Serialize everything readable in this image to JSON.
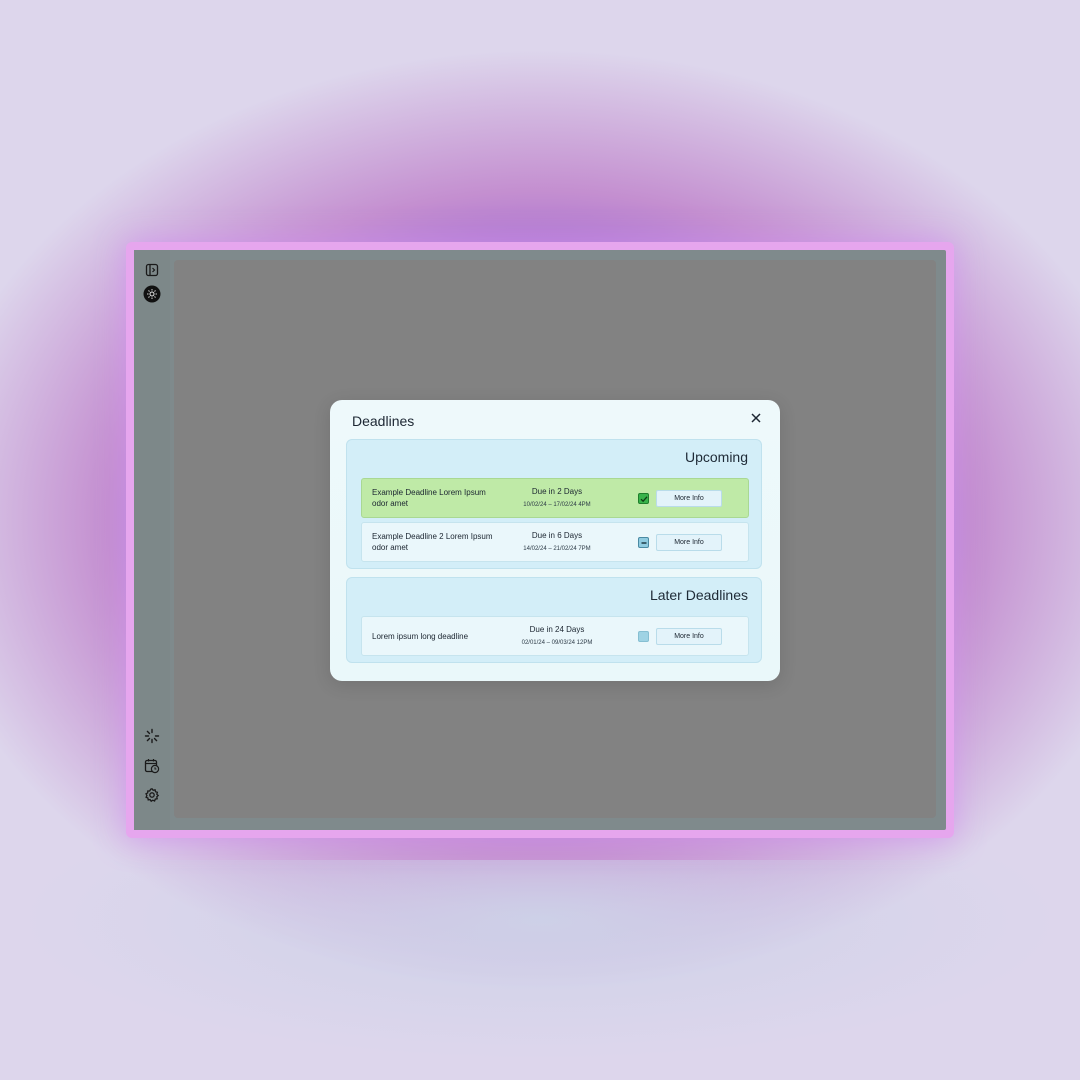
{
  "colors": {
    "backdrop": "#ddd6ec",
    "glow_purple": "#6a45e0",
    "device_frame": "#e6a6ee",
    "overlay": "#828282",
    "modal_bg": "#eef9fb",
    "section_bg": "#d3eef8",
    "done_row_bg": "#bfeaa7",
    "check_green": "#38b34a"
  },
  "sidebar": {
    "top_icons": [
      "sidebar-toggle-icon",
      "sun-icon"
    ],
    "bottom_icons": [
      "loading-spinner-icon",
      "calendar-clock-icon",
      "gear-icon"
    ]
  },
  "modal": {
    "title": "Deadlines",
    "close_icon": "close-icon",
    "sections": [
      {
        "title": "Upcoming",
        "rows": [
          {
            "name": "Example Deadline Lorem Ipsum odor amet",
            "due": "Due in 2 Days",
            "range": "10/02/24 – 17/02/24 4PM",
            "status": "checked",
            "button": "More Info"
          },
          {
            "name": "Example Deadline 2 Lorem Ipsum odor amet",
            "due": "Due in 6 Days",
            "range": "14/02/24 – 21/02/24 7PM",
            "status": "partial",
            "button": "More Info"
          }
        ]
      },
      {
        "title": "Later Deadlines",
        "rows": [
          {
            "name": "Lorem ipsum long deadline",
            "due": "Due in 24 Days",
            "range": "02/01/24 – 09/03/24 12PM",
            "status": "empty",
            "button": "More Info"
          }
        ]
      }
    ]
  }
}
